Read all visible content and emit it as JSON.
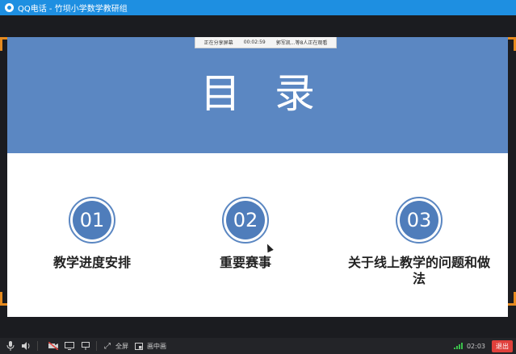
{
  "window": {
    "title": "QQ电话 - 竹坝小学数学教研组"
  },
  "share_bar": {
    "status": "正在分享屏幕",
    "timer": "00:02:59",
    "viewers": "郭军凯...等8人正在观看"
  },
  "slide": {
    "heading": "目录",
    "items": [
      {
        "number": "01",
        "label": "教学进度安排"
      },
      {
        "number": "02",
        "label": "重要赛事"
      },
      {
        "number": "03",
        "label": "关于线上教学的问题和做法"
      }
    ]
  },
  "toolbar": {
    "fullscreen_label": "全屏",
    "pip_label": "画中画",
    "time": "02:03",
    "exit_label": "退出"
  },
  "colors": {
    "titlebar": "#1e8fe1",
    "banner": "#5b87c2",
    "circle": "#4f7dbb",
    "exit": "#e0403b",
    "corner": "#e58a1f"
  }
}
